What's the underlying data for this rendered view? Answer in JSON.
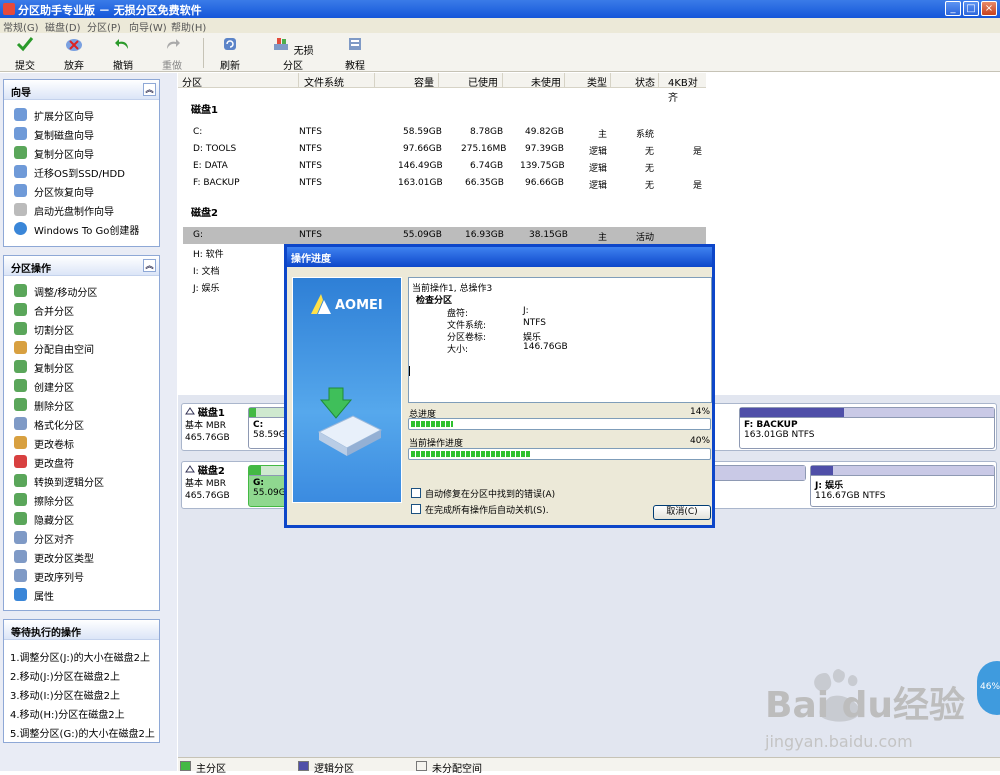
{
  "window": {
    "title": "分区助手专业版 － 无损分区免费软件"
  },
  "menu": [
    "常规(G)",
    "磁盘(D)",
    "分区(P)",
    "向导(W)",
    "帮助(H)"
  ],
  "toolbar": {
    "commit": "提交",
    "discard": "放弃",
    "undo": "撤销",
    "redo": "重做",
    "refresh": "刷新",
    "lossless": "无损分区",
    "tutorial": "教程"
  },
  "wizard_panel": {
    "title": "向导",
    "items": [
      "扩展分区向导",
      "复制磁盘向导",
      "复制分区向导",
      "迁移OS到SSD/HDD",
      "分区恢复向导",
      "启动光盘制作向导",
      "Windows To Go创建器"
    ]
  },
  "ops_panel": {
    "title": "分区操作",
    "items": [
      "调整/移动分区",
      "合并分区",
      "切割分区",
      "分配自由空间",
      "复制分区",
      "创建分区",
      "删除分区",
      "格式化分区",
      "更改卷标",
      "更改盘符",
      "转换到逻辑分区",
      "擦除分区",
      "隐藏分区",
      "分区对齐",
      "更改分区类型",
      "更改序列号",
      "属性"
    ]
  },
  "pending_panel": {
    "title": "等待执行的操作",
    "items": [
      "1.调整分区(J:)的大小在磁盘2上",
      "2.移动(J:)分区在磁盘2上",
      "3.移动(I:)分区在磁盘2上",
      "4.移动(H:)分区在磁盘2上",
      "5.调整分区(G:)的大小在磁盘2上"
    ]
  },
  "columns": [
    "分区",
    "文件系统",
    "容量",
    "已使用",
    "未使用",
    "类型",
    "状态",
    "4KB对齐"
  ],
  "disk1": {
    "label": "磁盘1",
    "rows": [
      [
        "C:",
        "NTFS",
        "58.59GB",
        "8.78GB",
        "49.82GB",
        "主",
        "系统",
        ""
      ],
      [
        "D: TOOLS",
        "NTFS",
        "97.66GB",
        "275.16MB",
        "97.39GB",
        "逻辑",
        "无",
        "是"
      ],
      [
        "E: DATA",
        "NTFS",
        "146.49GB",
        "6.74GB",
        "139.75GB",
        "逻辑",
        "无",
        ""
      ],
      [
        "F: BACKUP",
        "NTFS",
        "163.01GB",
        "66.35GB",
        "96.66GB",
        "逻辑",
        "无",
        "是"
      ]
    ]
  },
  "disk2": {
    "label": "磁盘2",
    "rows": [
      [
        "G:",
        "NTFS",
        "55.09GB",
        "16.93GB",
        "38.15GB",
        "主",
        "活动",
        ""
      ],
      [
        "H: 软件",
        "",
        "",
        "",
        "",
        "",
        "",
        ""
      ],
      [
        "I: 文档",
        "",
        "",
        "",
        "",
        "",
        "",
        ""
      ],
      [
        "J: 娱乐",
        "",
        "",
        "",
        "",
        "",
        "",
        ""
      ]
    ]
  },
  "diskmap": {
    "disk1": {
      "name": "磁盘1",
      "type": "基本 MBR",
      "size": "465.76GB",
      "c_name": "C:",
      "c_size": "58.59GB",
      "f_name": "F: BACKUP",
      "f_size": "163.01GB NTFS"
    },
    "disk2": {
      "name": "磁盘2",
      "type": "基本 MBR",
      "size": "465.76GB",
      "g_name": "G:",
      "g_size": "55.09GB",
      "j_name": "J: 娱乐",
      "j_size": "116.67GB NTFS"
    }
  },
  "legend": {
    "primary": "主分区",
    "logical": "逻辑分区",
    "unallocated": "未分配空间"
  },
  "dialog": {
    "title": "操作进度",
    "brand": "AOMEI",
    "log_line1": "当前操作1, 总操作3",
    "log_line2": "检查分区",
    "fields": [
      {
        "k": "盘符:",
        "v": "J:"
      },
      {
        "k": "文件系统:",
        "v": "NTFS"
      },
      {
        "k": "分区卷标:",
        "v": "娱乐"
      },
      {
        "k": "大小:",
        "v": "146.76GB"
      }
    ],
    "total_label": "总进度",
    "total_pct": "14%",
    "total_value": 14,
    "current_label": "当前操作进度",
    "current_pct": "40%",
    "current_value": 40,
    "check1": "自动修复在分区中找到的错误(A)",
    "check2": "在完成所有操作后自动关机(S).",
    "cancel": "取消(C)"
  },
  "watermark": {
    "brand": "Bai du经验",
    "url": "jingyan.baidu.com"
  },
  "bubble": "46%",
  "colors": {
    "primary": "#44b944",
    "logical": "#4f4fa8",
    "selected": "#bcbcbc"
  }
}
